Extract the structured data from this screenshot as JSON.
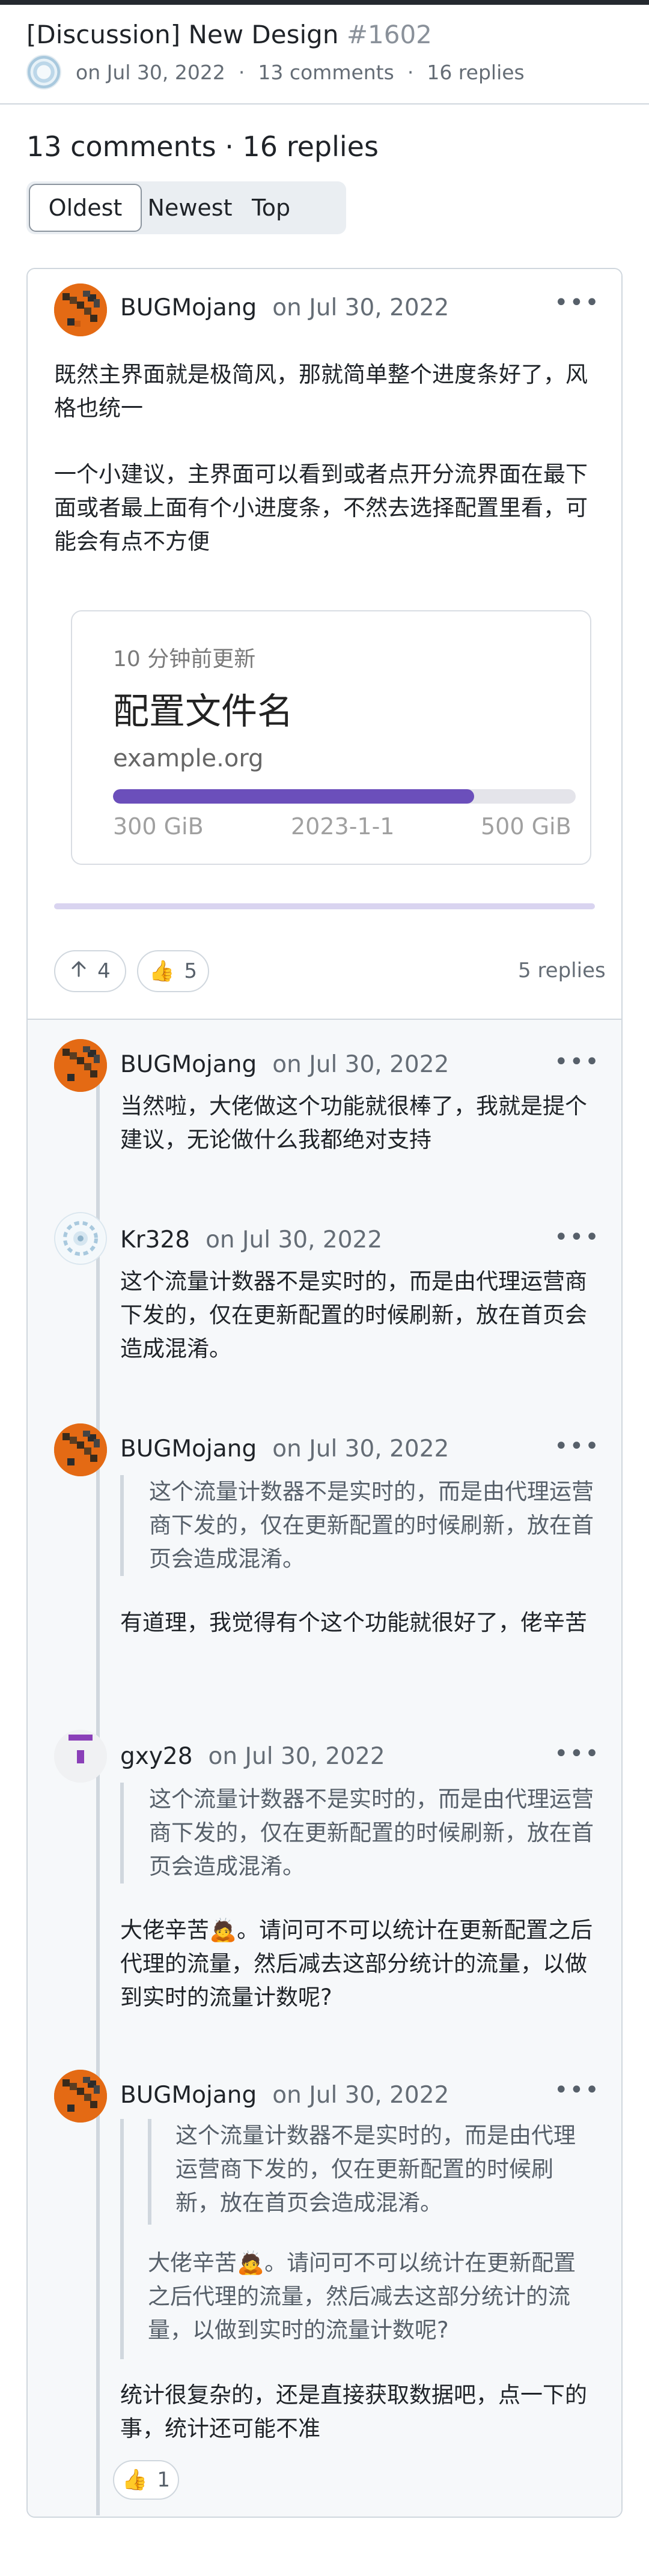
{
  "header": {
    "title": "[Discussion] New Design",
    "number": "#1602",
    "date": "on Jul 30, 2022",
    "comments": "13 comments",
    "replies": "16 replies"
  },
  "summary": {
    "title": "13 comments · 16 replies"
  },
  "sort_tabs": [
    "Oldest",
    "Newest",
    "Top"
  ],
  "main_comment": {
    "author": "BUGMojang",
    "date": "on Jul 30, 2022",
    "paragraphs": [
      "既然主界面就是极简风，那就简单整个进度条好了，风格也统一",
      "一个小建议，主界面可以看到或者点开分流界面在最下面或者最上面有个小进度条，不然去选择配置里看，可能会有点不方便"
    ],
    "preview": {
      "updated": "10 分钟前更新",
      "profile": "配置文件名",
      "domain": "example.org",
      "used": "300 GiB",
      "expiry": "2023-1-1",
      "total": "500 GiB",
      "progress": 0.78,
      "bar_color": "#6b4fbb"
    },
    "reactions": {
      "upvote": "4",
      "thumbs_up": "5"
    },
    "reply_count": "5 replies"
  },
  "replies": [
    {
      "author": "BUGMojang",
      "date": "on Jul 30, 2022",
      "text": "当然啦，大佬做这个功能就很棒了，我就是提个建议，无论做什么我都绝对支持"
    },
    {
      "author": "Kr328",
      "date": "on Jul 30, 2022",
      "text": "这个流量计数器不是实时的，而是由代理运营商下发的，仅在更新配置的时候刷新，放在首页会造成混淆。"
    },
    {
      "author": "BUGMojang",
      "date": "on Jul 30, 2022",
      "quote": "这个流量计数器不是实时的，而是由代理运营商下发的，仅在更新配置的时候刷新，放在首页会造成混淆。",
      "text": "有道理，我觉得有个这个功能就很好了，佬辛苦"
    },
    {
      "author": "gxy28",
      "date": "on Jul 30, 2022",
      "quote": "这个流量计数器不是实时的，而是由代理运营商下发的，仅在更新配置的时候刷新，放在首页会造成混淆。",
      "text": "大佬辛苦🙇。请问可不可以统计在更新配置之后代理的流量，然后减去这部分统计的流量，以做到实时的流量计数呢?"
    },
    {
      "author": "BUGMojang",
      "date": "on Jul 30, 2022",
      "quote_inner": "这个流量计数器不是实时的，而是由代理运营商下发的，仅在更新配置的时候刷新，放在首页会造成混淆。",
      "quote": "大佬辛苦🙇。请问可不可以统计在更新配置之后代理的流量，然后减去这部分统计的流量，以做到实时的流量计数呢?",
      "text": "统计很复杂的，还是直接获取数据吧，点一下的事，统计还可能不准",
      "thumbs_up": "1"
    }
  ],
  "icons": {
    "more": "kebab-horizontal-icon",
    "upvote": "arrow-up-icon",
    "thumbs_up": "thumbs-up-emoji"
  },
  "colors": {
    "border": "#d0d7de",
    "muted": "#656d76",
    "accent_progress": "#6b4fbb"
  }
}
